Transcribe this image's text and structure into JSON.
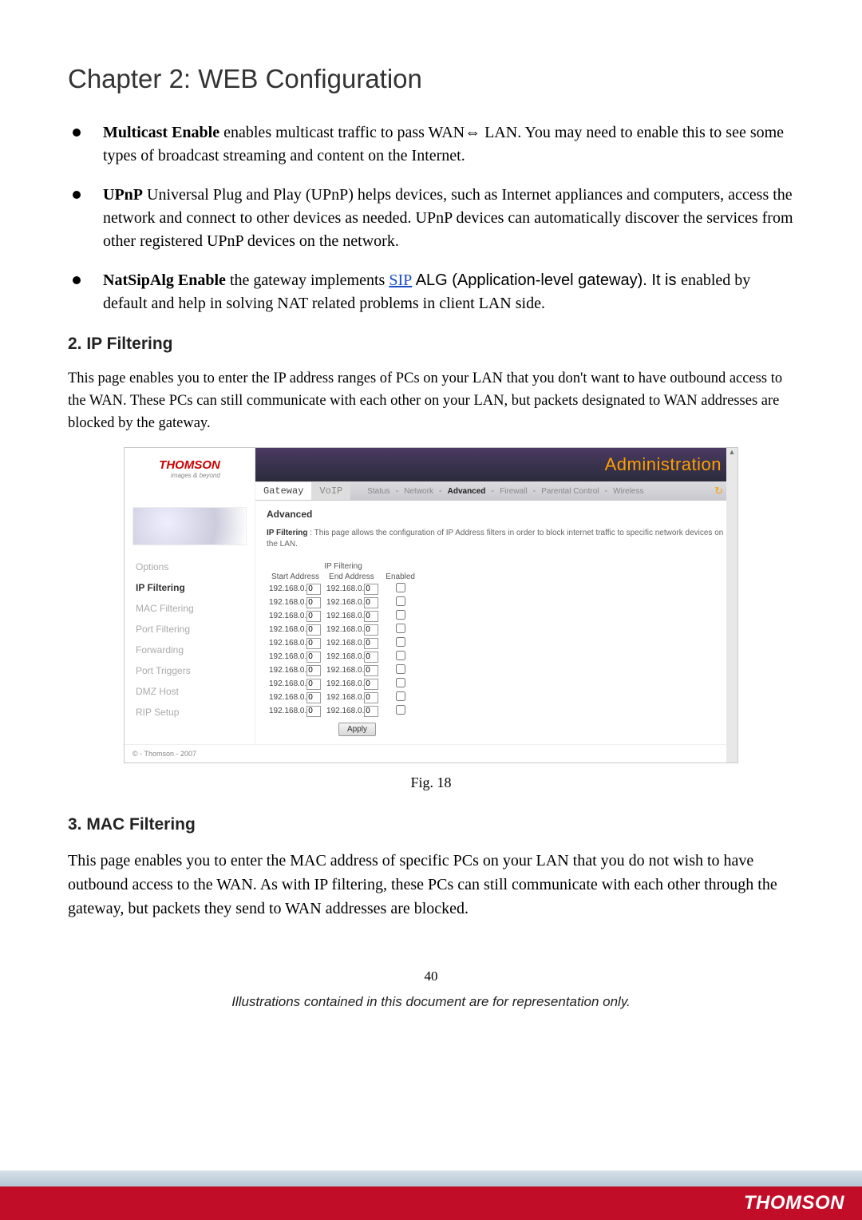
{
  "chapter_title": "Chapter 2: WEB Configuration",
  "bullets": {
    "multicast": {
      "term": "Multicast Enable",
      "rest": " enables multicast traffic to pass WAN",
      "arrow": "⇔",
      "rest2": " LAN. You may need to enable this to see some types of broadcast streaming and content on the Internet."
    },
    "upnp": {
      "term": "UPnP",
      "rest": " Universal Plug and Play (UPnP) helps devices, such as Internet appliances and computers, access the network and connect to other devices as needed. UPnP devices can automatically discover the services from other registered UPnP devices on the network."
    },
    "natsip": {
      "term": "NatSipAlg Enable",
      "pre": " the gateway implements ",
      "link": "SIP",
      "mid": " ALG (Application-level gateway). It is ",
      "post": "enabled by default and help in solving NAT related problems in client LAN side."
    }
  },
  "section_ip_title": "2. IP Filtering",
  "section_ip_body": "This page enables you to enter the IP address ranges of PCs on your LAN that you don't want to have outbound access to the WAN. These PCs can still communicate with each other on your LAN, but packets designated to WAN addresses are blocked by the gateway.",
  "screenshot": {
    "logo": "THOMSON",
    "tagline": "images & beyond",
    "header_title": "Administration",
    "main_tabs": [
      "Gateway",
      "VoIP"
    ],
    "sub_tabs": [
      "Status",
      "Network",
      "Advanced",
      "Firewall",
      "Parental Control",
      "Wireless"
    ],
    "sub_active_index": 2,
    "panel_title": "Advanced",
    "panel_name": "IP Filtering",
    "panel_desc": " : This page allows the configuration of IP Address filters in order to block internet traffic to specific network devices on the LAN.",
    "nav_items": [
      "Options",
      "IP Filtering",
      "MAC Filtering",
      "Port Filtering",
      "Forwarding",
      "Port Triggers",
      "DMZ Host",
      "RIP Setup"
    ],
    "nav_active_index": 1,
    "table_caption": "IP Filtering",
    "table_headers": [
      "Start Address",
      "End Address",
      "Enabled"
    ],
    "ip_prefix": "192.168.0.",
    "ip_value": "0",
    "row_count": 10,
    "apply_label": "Apply",
    "copyright": "© - Thomson - 2007"
  },
  "fig_caption": "Fig. 18",
  "section_mac_title": "3. MAC Filtering",
  "section_mac_body": "This page enables you to enter the MAC address of specific PCs on your LAN that you do not wish to have outbound access to the WAN. As with IP filtering, these PCs can still communicate with each other through the gateway, but packets they send to WAN addresses are blocked.",
  "page_number": "40",
  "disclaimer": "Illustrations contained in this document are for representation only.",
  "footer_brand": "THOMSON"
}
